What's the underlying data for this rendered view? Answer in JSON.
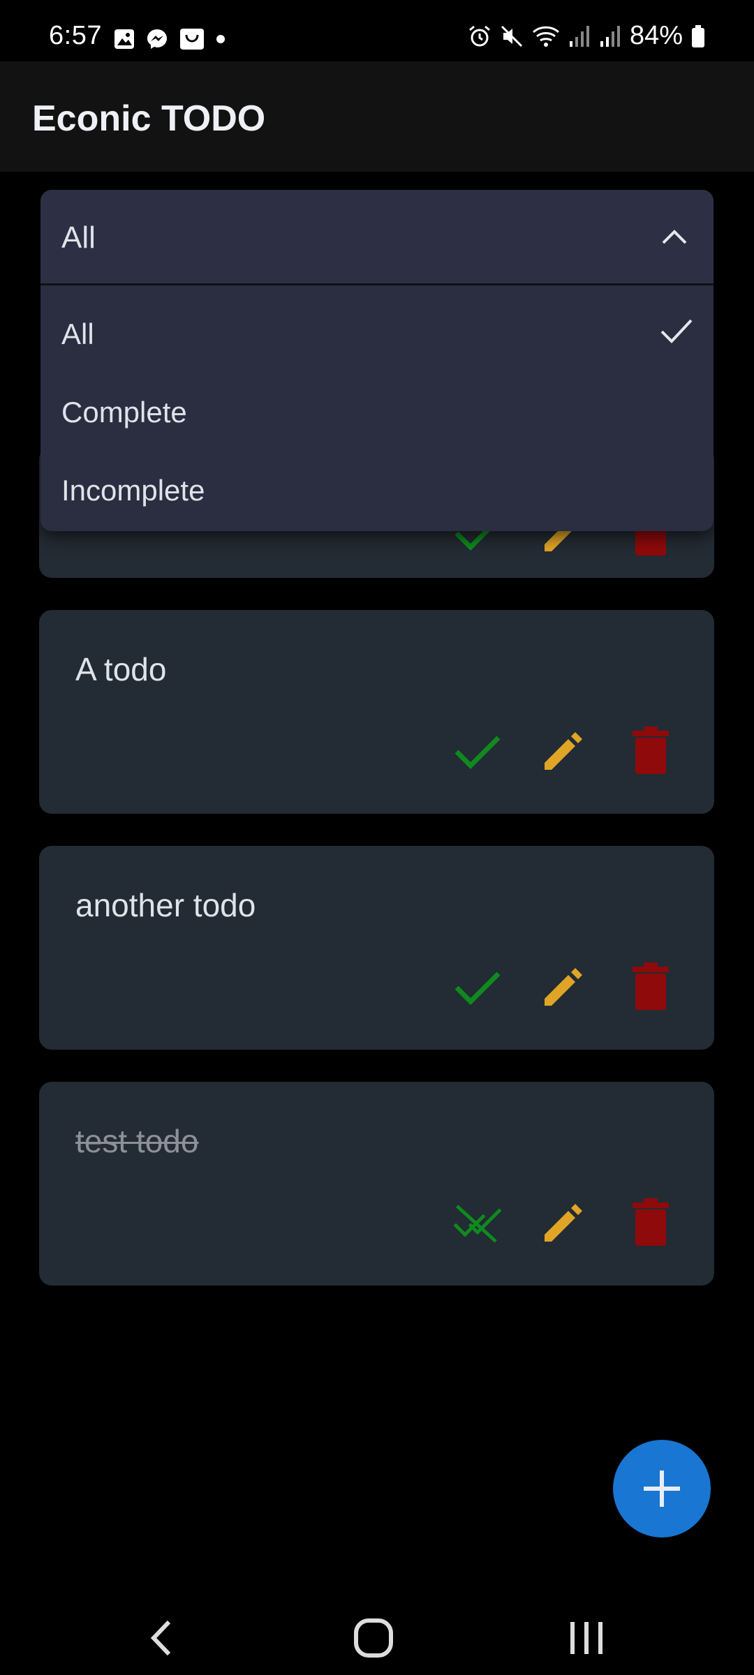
{
  "status_bar": {
    "time": "6:57",
    "battery": "84%",
    "left_icons": [
      "gallery-icon",
      "messenger-icon",
      "shopping-bag-icon",
      "dot-icon"
    ],
    "right_icons": [
      "alarm-icon",
      "mute-icon",
      "wifi-icon",
      "signal-icon",
      "signal-icon",
      "battery-icon"
    ]
  },
  "app_bar": {
    "title": "Econic TODO"
  },
  "filter": {
    "selected": "All",
    "options": [
      "All",
      "Complete",
      "Incomplete"
    ]
  },
  "todos": [
    {
      "title": "A todo",
      "done": false
    },
    {
      "title": "another todo",
      "done": false
    },
    {
      "title": "test todo",
      "done": true
    }
  ],
  "colors": {
    "complete": "#0f8a1e",
    "edit": "#e0a526",
    "delete": "#8f0a0a",
    "fab": "#1976d2",
    "card_bg": "#232b34",
    "dropdown_bg": "#2a2e40"
  },
  "fab": {
    "icon": "plus-icon"
  },
  "nav_bar": {
    "icons": [
      "back-icon",
      "home-icon",
      "recents-icon"
    ]
  }
}
